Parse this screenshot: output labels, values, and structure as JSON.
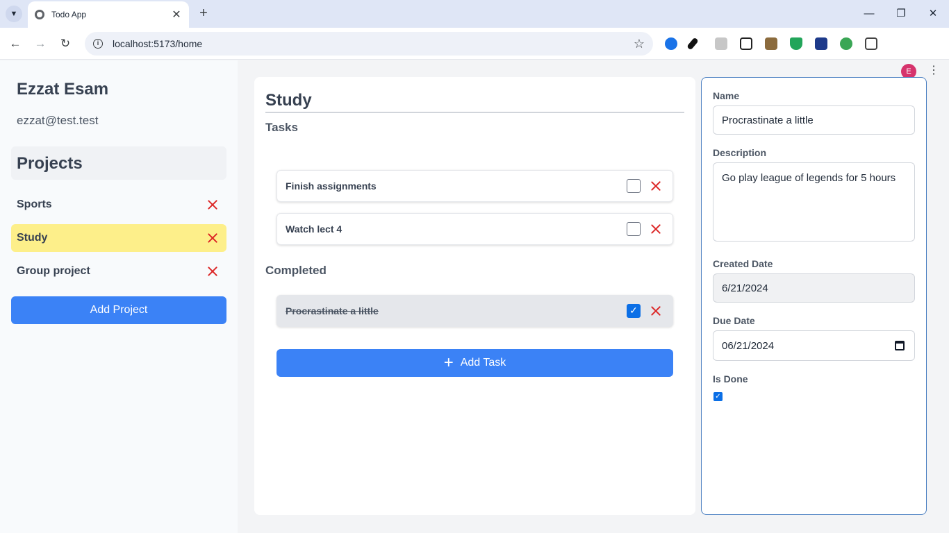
{
  "browser": {
    "tab_title": "Todo App",
    "url": "localhost:5173/home",
    "profile_initial": "E"
  },
  "user": {
    "name": "Ezzat Esam",
    "email": "ezzat@test.test"
  },
  "sidebar": {
    "projects_heading": "Projects",
    "projects": [
      {
        "label": "Sports",
        "active": false
      },
      {
        "label": "Study",
        "active": true
      },
      {
        "label": "Group project",
        "active": false
      }
    ],
    "add_project_label": "Add Project"
  },
  "main": {
    "project_title": "Study",
    "tasks_heading": "Tasks",
    "tasks": [
      {
        "label": "Finish assignments",
        "done": false
      },
      {
        "label": "Watch lect 4",
        "done": false
      }
    ],
    "completed_heading": "Completed",
    "completed": [
      {
        "label": "Procrastinate a little",
        "done": true
      }
    ],
    "add_task_label": "Add Task"
  },
  "detail": {
    "name_label": "Name",
    "name_value": "Procrastinate a little",
    "description_label": "Description",
    "description_value": "Go play league of legends for 5 hours",
    "created_label": "Created Date",
    "created_value": "6/21/2024",
    "due_label": "Due Date",
    "due_value": "06/21/2024",
    "is_done_label": "Is Done",
    "is_done": true
  },
  "colors": {
    "accent": "#3b82f6",
    "active_project": "#fdef8a",
    "delete": "#dc2626"
  }
}
